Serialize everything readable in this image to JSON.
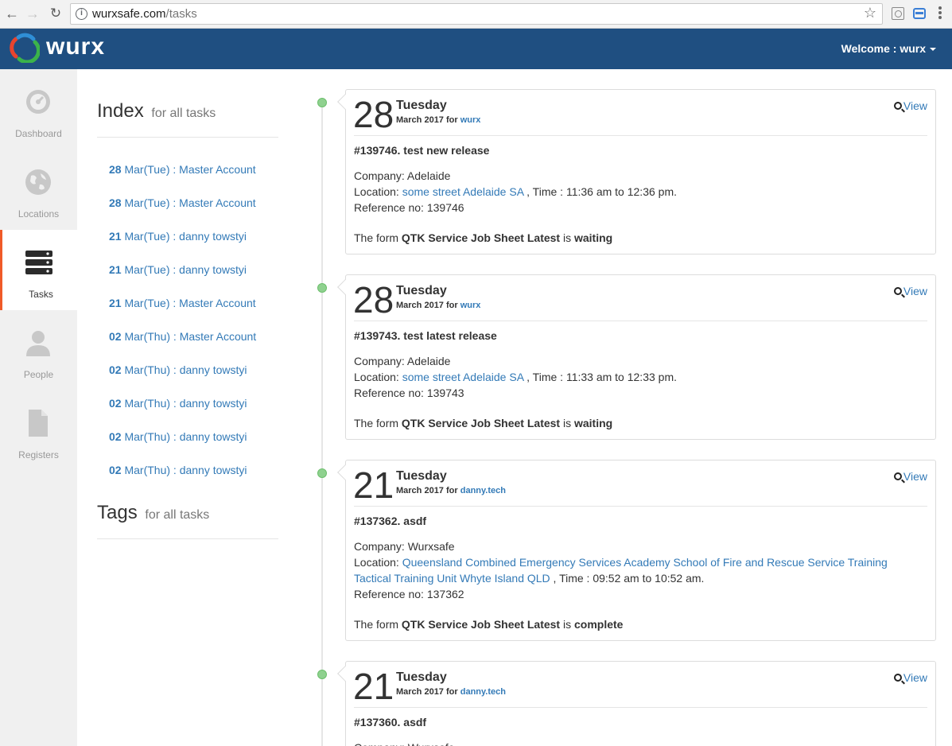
{
  "browser": {
    "url_host": "wurxsafe.com",
    "url_path": "/tasks"
  },
  "header": {
    "brand": "wurx",
    "welcome": "Welcome : wurx"
  },
  "sidebar": {
    "items": [
      {
        "label": "Dashboard",
        "icon": "dashboard-icon"
      },
      {
        "label": "Locations",
        "icon": "globe-icon"
      },
      {
        "label": "Tasks",
        "icon": "server-icon",
        "active": true
      },
      {
        "label": "People",
        "icon": "person-icon"
      },
      {
        "label": "Registers",
        "icon": "document-icon"
      }
    ]
  },
  "index": {
    "title": "Index",
    "subtitle": "for all tasks",
    "links": [
      {
        "day": "28",
        "rest": "Mar(Tue) : Master Account"
      },
      {
        "day": "28",
        "rest": "Mar(Tue) : Master Account"
      },
      {
        "day": "21",
        "rest": "Mar(Tue) : danny towstyi"
      },
      {
        "day": "21",
        "rest": "Mar(Tue) : danny towstyi"
      },
      {
        "day": "21",
        "rest": "Mar(Tue) : Master Account"
      },
      {
        "day": "02",
        "rest": "Mar(Thu) : Master Account"
      },
      {
        "day": "02",
        "rest": "Mar(Thu) : danny towstyi"
      },
      {
        "day": "02",
        "rest": "Mar(Thu) : danny towstyi"
      },
      {
        "day": "02",
        "rest": "Mar(Thu) : danny towstyi"
      },
      {
        "day": "02",
        "rest": "Mar(Thu) : danny towstyi"
      }
    ]
  },
  "tags": {
    "title": "Tags",
    "subtitle": "for all tasks"
  },
  "tasks": [
    {
      "day": "28",
      "weekday": "Tuesday",
      "month": "March 2017",
      "for_label": "for",
      "user": "wurx",
      "view": "View",
      "title": "#139746. test new release",
      "company": "Company: Adelaide",
      "location_prefix": "Location: ",
      "location": "some street Adelaide SA",
      "time": " , Time : 11:36 am to 12:36 pm.",
      "reference": "Reference no: 139746",
      "form_prefix": "The form ",
      "form_name": "QTK Service Job Sheet Latest",
      "form_mid": " is ",
      "form_status": "waiting"
    },
    {
      "day": "28",
      "weekday": "Tuesday",
      "month": "March 2017",
      "for_label": "for",
      "user": "wurx",
      "view": "View",
      "title": "#139743. test latest release",
      "company": "Company: Adelaide",
      "location_prefix": "Location: ",
      "location": "some street Adelaide SA",
      "time": " , Time : 11:33 am to 12:33 pm.",
      "reference": "Reference no: 139743",
      "form_prefix": "The form ",
      "form_name": "QTK Service Job Sheet Latest",
      "form_mid": " is ",
      "form_status": "waiting"
    },
    {
      "day": "21",
      "weekday": "Tuesday",
      "month": "March 2017",
      "for_label": "for",
      "user": "danny.tech",
      "view": "View",
      "title": "#137362. asdf",
      "company": "Company: Wurxsafe",
      "location_prefix": "Location: ",
      "location": "Queensland Combined Emergency Services Academy School of Fire and Rescue Service Training Tactical Training Unit Whyte Island QLD",
      "time": " , Time : 09:52 am to 10:52 am.",
      "reference": "Reference no: 137362",
      "form_prefix": "The form ",
      "form_name": "QTK Service Job Sheet Latest",
      "form_mid": " is ",
      "form_status": "complete"
    },
    {
      "day": "21",
      "weekday": "Tuesday",
      "month": "March 2017",
      "for_label": "for",
      "user": "danny.tech",
      "view": "View",
      "title": "#137360. asdf",
      "company": "Company: Wurxsafe"
    }
  ]
}
